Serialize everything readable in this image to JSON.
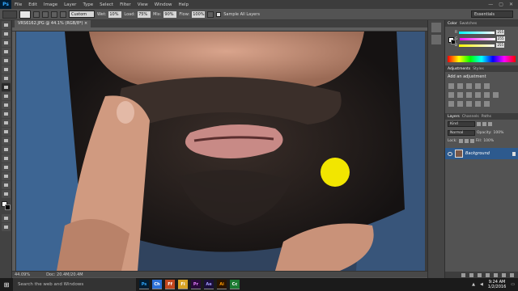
{
  "app": {
    "logo": "Ps"
  },
  "menu": [
    "File",
    "Edit",
    "Image",
    "Layer",
    "Type",
    "Select",
    "Filter",
    "View",
    "Window",
    "Help"
  ],
  "window_controls": [
    "—",
    "▢",
    "✕"
  ],
  "options": {
    "mode_label": "Mode:",
    "mode_value": "Custom",
    "wet_label": "Wet:",
    "wet_value": "10%",
    "load_label": "Load:",
    "load_value": "75%",
    "mix_label": "Mix:",
    "mix_value": "90%",
    "flow_label": "Flow:",
    "flow_value": "100%",
    "sample_all_layers": "Sample All Layers"
  },
  "workspace": "Essentials",
  "document": {
    "tab_title": "VRS6162.JPG @ 44.1% (RGB/8*) ×"
  },
  "status": {
    "zoom": "44.09%",
    "doc": "Doc: 20.4M/20.4M"
  },
  "color_panel": {
    "tabs": [
      "Color",
      "Swatches"
    ],
    "sliders": [
      {
        "label": "R",
        "value": "255"
      },
      {
        "label": "G",
        "value": "255"
      },
      {
        "label": "B",
        "value": "255"
      }
    ]
  },
  "adjustments": {
    "tabs": [
      "Adjustments",
      "Styles"
    ],
    "heading": "Add an adjustment"
  },
  "layers": {
    "tabs": [
      "Layers",
      "Channels",
      "Paths"
    ],
    "kind": "Kind",
    "blend": "Normal",
    "opacity_label": "Opacity:",
    "opacity_value": "100%",
    "lock_label": "Lock:",
    "fill_label": "Fill:",
    "fill_value": "100%",
    "layer_name": "Background"
  },
  "taskbar": {
    "search_placeholder": "Search the web and Windows",
    "apps": [
      "Ps",
      "Ch",
      "Ff",
      "Fi",
      "Pr",
      "Ae",
      "Ai",
      "Cc"
    ],
    "time": "9:24 AM",
    "date": "1/2/2016"
  },
  "colors": {
    "accent": "#31a8ff",
    "layer_selected": "#2d5a8e",
    "cursor": "#f2e600"
  }
}
